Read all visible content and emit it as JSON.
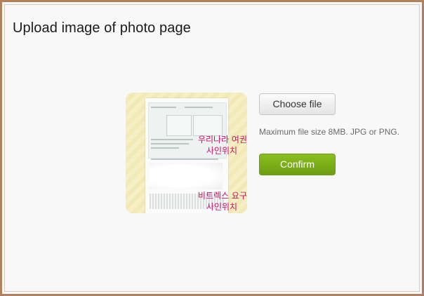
{
  "page": {
    "title": "Upload image of photo page"
  },
  "preview": {
    "annotation_top_line1": "우리나라 여권",
    "annotation_top_line2": "사인위치",
    "annotation_bottom_line1": "비트렉스 요구",
    "annotation_bottom_line2": "사인위치"
  },
  "upload": {
    "choose_file_label": "Choose file",
    "hint": "Maximum file size 8MB. JPG or PNG.",
    "confirm_label": "Confirm"
  },
  "colors": {
    "frame_border": "#b47f5c",
    "confirm_green": "#7cac18",
    "annotation_magenta": "#cc1166"
  }
}
